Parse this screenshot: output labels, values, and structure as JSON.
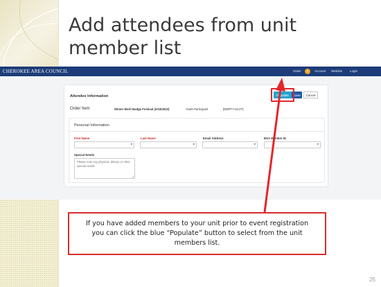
{
  "slide": {
    "title": "Add attendees from unit member list",
    "number": "25"
  },
  "nav": {
    "org_name": "CHEROKEE AREA COUNCIL",
    "links": {
      "order": "Order",
      "order_count": "1",
      "account": "Account",
      "website": "Website",
      "login": "Login"
    }
  },
  "form": {
    "heading": "Attendee Information",
    "buttons": {
      "populate": "Populate",
      "save": "Save",
      "cancel": "Cancel"
    },
    "order_item": {
      "label": "Order Item",
      "event": "Winter Merit Badge Festival (2/19/2022)",
      "type": "Youth Participant",
      "slot": "[EMPTY-SLOT]"
    },
    "personal": {
      "heading": "Personal Information",
      "fields": {
        "first_name": {
          "label": "First Name",
          "value": ""
        },
        "last_name": {
          "label": "Last Name",
          "value": ""
        },
        "email": {
          "label": "Email Address",
          "value": ""
        },
        "bsa_id": {
          "label": "BSA Member ID",
          "value": ""
        }
      },
      "special_needs": {
        "label": "Special Needs",
        "placeholder": "Please note any physical, dietary or other special needs"
      }
    }
  },
  "callout": {
    "text": "If you have added members to your unit prior to event registration you can click the blue “Populate” button to select from the unit members list."
  },
  "colors": {
    "nav_bg": "#1d3c79",
    "populate": "#28a3cc",
    "save": "#1e5aa8",
    "highlight": "#e3262a",
    "required": "#c0262b"
  }
}
